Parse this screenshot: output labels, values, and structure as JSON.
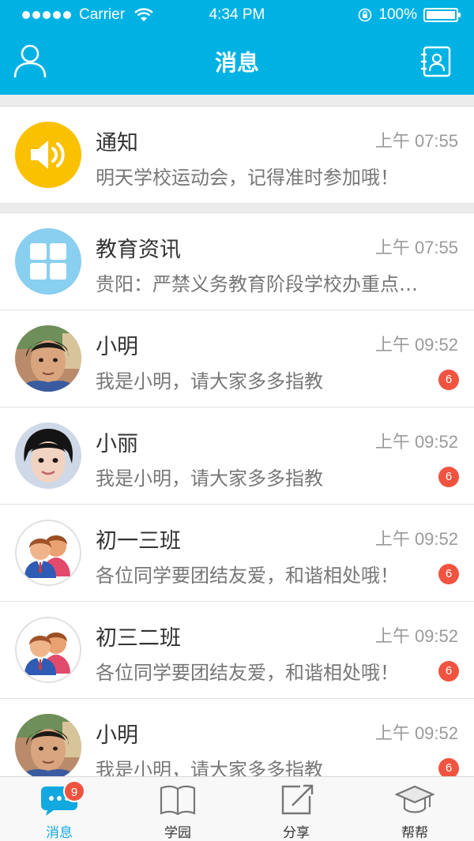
{
  "status_bar": {
    "carrier": "Carrier",
    "time": "4:34 PM",
    "battery": "100%"
  },
  "header": {
    "title": "消息"
  },
  "messages": [
    {
      "title": "通知",
      "time": "上午 07:55",
      "preview": "明天学校运动会，记得准时参加哦！",
      "avatar": "speaker-icon"
    },
    {
      "title": "教育资讯",
      "time": "上午 07:55",
      "preview": "贵阳：严禁义务教育阶段学校办重点…",
      "avatar": "grid-icon"
    },
    {
      "title": "小明",
      "time": "上午 09:52",
      "preview": "我是小明，请大家多多指教",
      "badge": "6",
      "avatar": "boy-photo"
    },
    {
      "title": "小丽",
      "time": "上午 09:52",
      "preview": "我是小明，请大家多多指教",
      "badge": "6",
      "avatar": "girl-photo"
    },
    {
      "title": "初一三班",
      "time": "上午 09:52",
      "preview": "各位同学要团结友爱，和谐相处哦！",
      "badge": "6",
      "avatar": "group-icon"
    },
    {
      "title": "初三二班",
      "time": "上午 09:52",
      "preview": "各位同学要团结友爱，和谐相处哦！",
      "badge": "6",
      "avatar": "group-icon"
    },
    {
      "title": "小明",
      "time": "上午 09:52",
      "preview": "我是小明，请大家多多指教",
      "badge": "6",
      "avatar": "boy-photo"
    }
  ],
  "tabs": [
    {
      "label": "消息",
      "badge": "9",
      "icon": "chat-bubble-icon",
      "active": true
    },
    {
      "label": "学园",
      "icon": "book-icon"
    },
    {
      "label": "分享",
      "icon": "share-icon"
    },
    {
      "label": "帮帮",
      "icon": "graduation-cap-icon"
    }
  ],
  "colors": {
    "primary": "#00b2e4",
    "badge": "#f05340",
    "notice": "#f9c100",
    "news": "#89cff0"
  }
}
